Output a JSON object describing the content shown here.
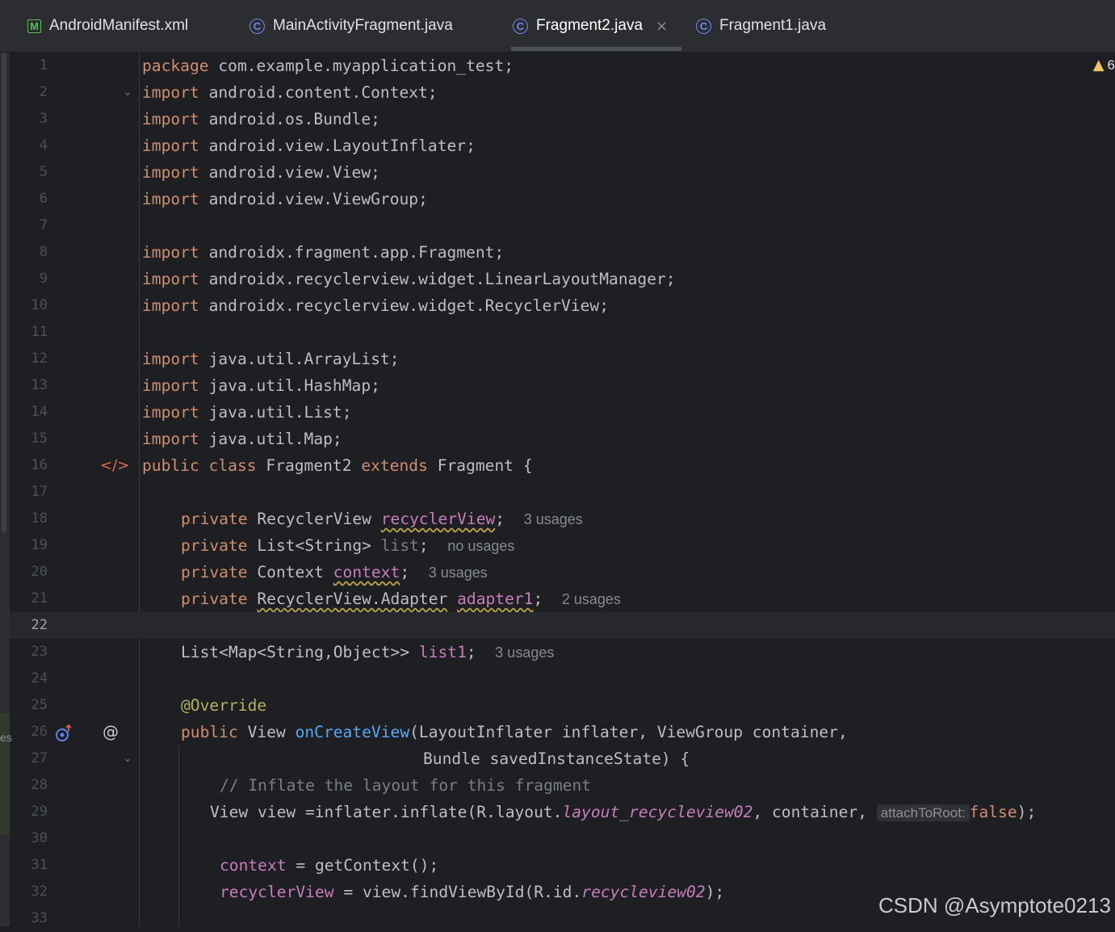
{
  "tabs": [
    {
      "label": "AndroidManifest.xml",
      "icon": "manifest-file-icon"
    },
    {
      "label": "MainActivityFragment.java",
      "icon": "java-class-icon"
    },
    {
      "label": "Fragment2.java",
      "icon": "java-class-icon",
      "active": true,
      "close": "×"
    },
    {
      "label": "Fragment1.java",
      "icon": "java-class-icon"
    }
  ],
  "tab_icons": {
    "manifest": "M",
    "class": "C"
  },
  "inspections": {
    "warning_count": "6"
  },
  "lines": [
    "1",
    "2",
    "3",
    "4",
    "5",
    "6",
    "7",
    "8",
    "9",
    "10",
    "11",
    "12",
    "13",
    "14",
    "15",
    "16",
    "17",
    "18",
    "19",
    "20",
    "21",
    "22",
    "23",
    "24",
    "25",
    "26",
    "27",
    "28",
    "29",
    "30",
    "31",
    "32",
    "33"
  ],
  "code": {
    "l1": {
      "kw": "package",
      "rest": " com.example.myapplication_test;"
    },
    "l2": {
      "kw": "import",
      "rest": " android.content.Context;"
    },
    "l3": {
      "kw": "import",
      "rest": " android.os.Bundle;"
    },
    "l4": {
      "kw": "import",
      "rest": " android.view.LayoutInflater;"
    },
    "l5": {
      "kw": "import",
      "rest": " android.view.View;"
    },
    "l6": {
      "kw": "import",
      "rest": " android.view.ViewGroup;"
    },
    "l8": {
      "kw": "import",
      "rest": " androidx.fragment.app.Fragment;"
    },
    "l9": {
      "kw": "import",
      "rest": " androidx.recyclerview.widget.LinearLayoutManager;"
    },
    "l10": {
      "kw": "import",
      "rest": " androidx.recyclerview.widget.RecyclerView;"
    },
    "l12": {
      "kw": "import",
      "rest": " java.util.ArrayList;"
    },
    "l13": {
      "kw": "import",
      "rest": " java.util.HashMap;"
    },
    "l14": {
      "kw": "import",
      "rest": " java.util.List;"
    },
    "l15": {
      "kw": "import",
      "rest": " java.util.Map;"
    },
    "l16": {
      "kw1": "public class",
      "name": " Fragment2 ",
      "kw2": "extends",
      "rest": " Fragment {"
    },
    "l18": {
      "kw": "private",
      "type": " RecyclerView ",
      "field": "recyclerView",
      "end": ";",
      "hint": "3 usages"
    },
    "l19": {
      "kw": "private",
      "type": " List<String> ",
      "field": "list",
      "end": ";",
      "hint": "no usages"
    },
    "l20": {
      "kw": "private",
      "type": " Context ",
      "field": "context",
      "end": ";",
      "hint": "3 usages"
    },
    "l21": {
      "kw": "private",
      "type_u": "RecyclerView.Adapter",
      "field": "adapter1",
      "end": ";",
      "hint": "2 usages"
    },
    "l23": {
      "type": "List<Map<String,Object>> ",
      "field": "list1",
      "end": ";",
      "hint": "3 usages"
    },
    "l25": {
      "ann": "@Override"
    },
    "l26": {
      "kw": "public",
      "type": " View ",
      "fn": "onCreateView",
      "rest": "(LayoutInflater inflater, ViewGroup container,"
    },
    "l27": {
      "rest": "Bundle savedInstanceState) {"
    },
    "l28": {
      "cmt": "// Inflate the layout for this fragment"
    },
    "l29": {
      "a": "View view =inflater.inflate(R.layout.",
      "ital": "layout_recycleview02",
      "b": ", container, ",
      "param": "attachToRoot:",
      "kw": "false",
      "c": ");"
    },
    "l31": {
      "field": "context",
      "rest": " = getContext();"
    },
    "l32": {
      "field": "recyclerView",
      "a": " = view.findViewById(R.id.",
      "ital": "recycleview02",
      "b": ");"
    }
  },
  "gutter_icons": {
    "l16": "implemented-by-icon",
    "l26_left": "override-method-icon",
    "l26_right": "annotation-icon"
  },
  "edge": {
    "text": "es"
  },
  "watermark": "CSDN @Asymptote0213"
}
